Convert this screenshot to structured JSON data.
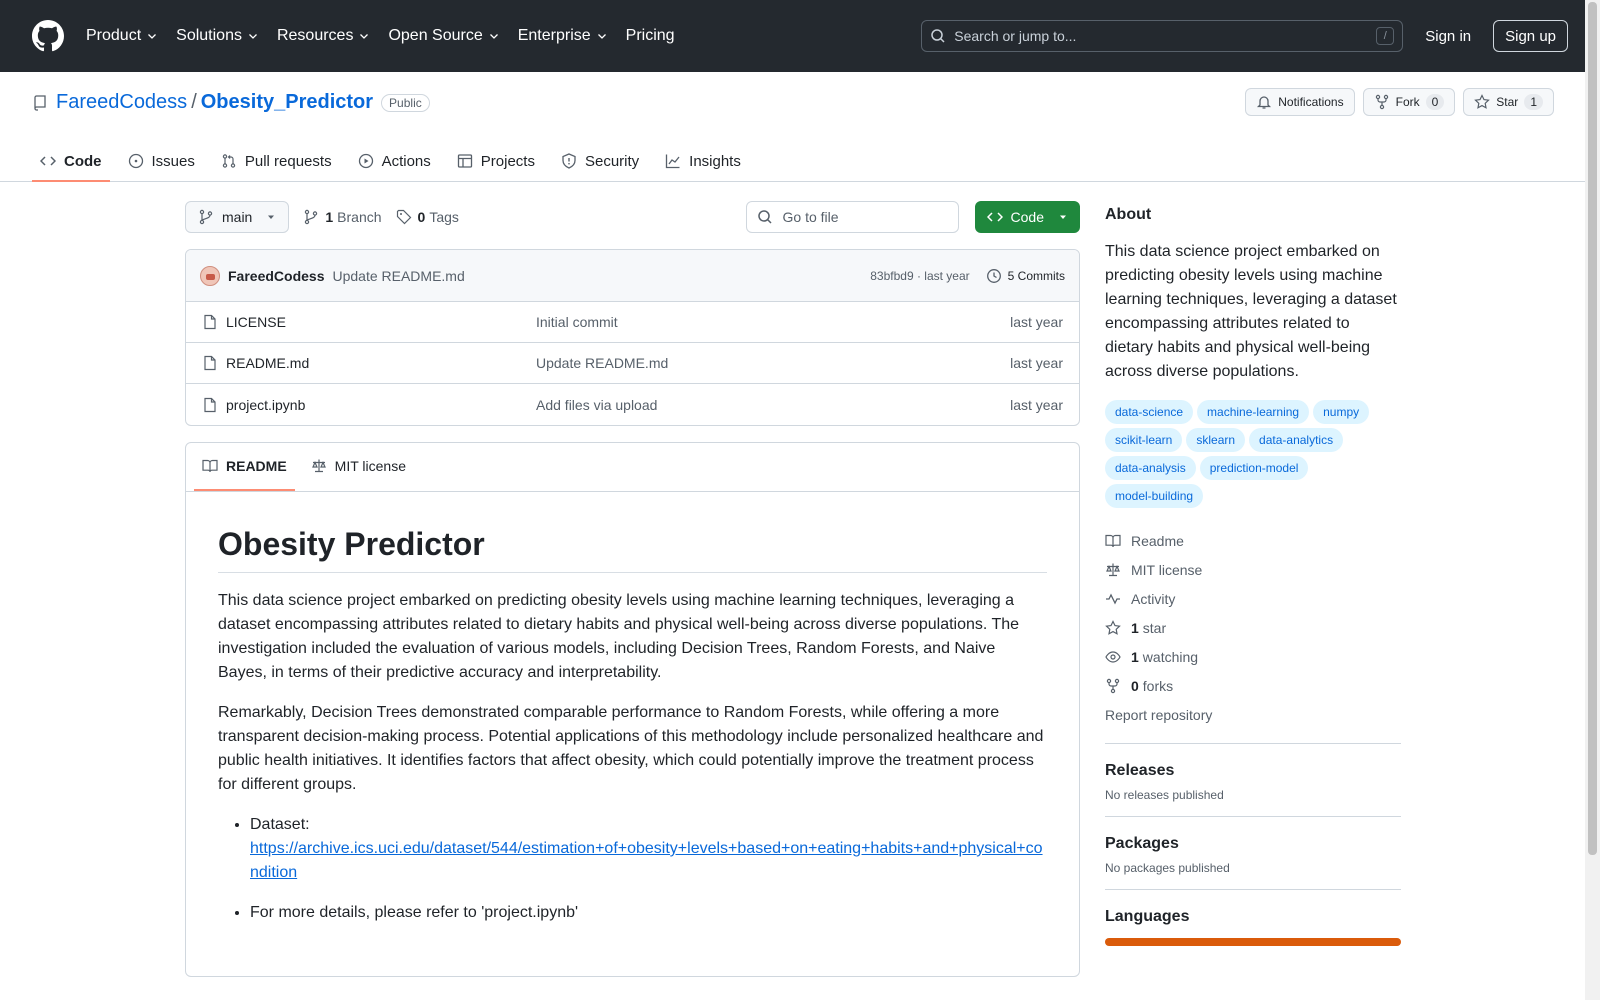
{
  "header": {
    "nav": [
      "Product",
      "Solutions",
      "Resources",
      "Open Source",
      "Enterprise",
      "Pricing"
    ],
    "search_placeholder": "Search or jump to...",
    "search_key": "/",
    "sign_in": "Sign in",
    "sign_up": "Sign up"
  },
  "repo": {
    "owner": "FareedCodess",
    "separator": "/",
    "name": "Obesity_Predictor",
    "visibility": "Public",
    "notifications": "Notifications",
    "fork_label": "Fork",
    "fork_count": "0",
    "star_label": "Star",
    "star_count": "1",
    "tabs": [
      "Code",
      "Issues",
      "Pull requests",
      "Actions",
      "Projects",
      "Security",
      "Insights"
    ]
  },
  "toolbar": {
    "branch": "main",
    "branch_count": "1",
    "branch_label": "Branch",
    "tag_count": "0",
    "tag_label": "Tags",
    "goto_placeholder": "Go to file",
    "code_button": "Code"
  },
  "commit": {
    "author": "FareedCodess",
    "message": "Update README.md",
    "hash": "83bfbd9",
    "dot": " · ",
    "time": "last year",
    "commits": "5 Commits"
  },
  "files": [
    {
      "name": "LICENSE",
      "commit": "Initial commit",
      "time": "last year"
    },
    {
      "name": "README.md",
      "commit": "Update README.md",
      "time": "last year"
    },
    {
      "name": "project.ipynb",
      "commit": "Add files via upload",
      "time": "last year"
    }
  ],
  "readme": {
    "tab_readme": "README",
    "tab_license": "MIT license",
    "title": "Obesity Predictor",
    "p1": "This data science project embarked on predicting obesity levels using machine learning techniques, leveraging a dataset encompassing attributes related to dietary habits and physical well-being across diverse populations. The investigation included the evaluation of various models, including Decision Trees, Random Forests, and Naive Bayes, in terms of their predictive accuracy and interpretability.",
    "p2": "Remarkably, Decision Trees demonstrated comparable performance to Random Forests, while offering a more transparent decision-making process. Potential applications of this methodology include personalized healthcare and public health initiatives. It identifies factors that affect obesity, which could potentially improve the treatment process for different groups.",
    "dataset_label": "Dataset:",
    "dataset_url": "https://archive.ics.uci.edu/dataset/544/estimation+of+obesity+levels+based+on+eating+habits+and+physical+condition",
    "more": "For more details, please refer to 'project.ipynb'"
  },
  "about": {
    "heading": "About",
    "description": "This data science project embarked on predicting obesity levels using machine learning techniques, leveraging a dataset encompassing attributes related to dietary habits and physical well-being across diverse populations.",
    "topics": [
      "data-science",
      "machine-learning",
      "numpy",
      "scikit-learn",
      "sklearn",
      "data-analytics",
      "data-analysis",
      "prediction-model",
      "model-building"
    ],
    "readme": "Readme",
    "license": "MIT license",
    "activity": "Activity",
    "stars_count": "1",
    "stars_label": "star",
    "watching_count": "1",
    "watching_label": "watching",
    "forks_count": "0",
    "forks_label": "forks",
    "report": "Report repository"
  },
  "releases": {
    "heading": "Releases",
    "note": "No releases published"
  },
  "packages": {
    "heading": "Packages",
    "note": "No packages published"
  },
  "languages": {
    "heading": "Languages"
  },
  "colors": {
    "accent": "#0969da",
    "header_bg": "#24292f",
    "code_green": "#1f883d",
    "tab_underline": "#fd8c73",
    "lang_bar": "#DA5B0B"
  }
}
